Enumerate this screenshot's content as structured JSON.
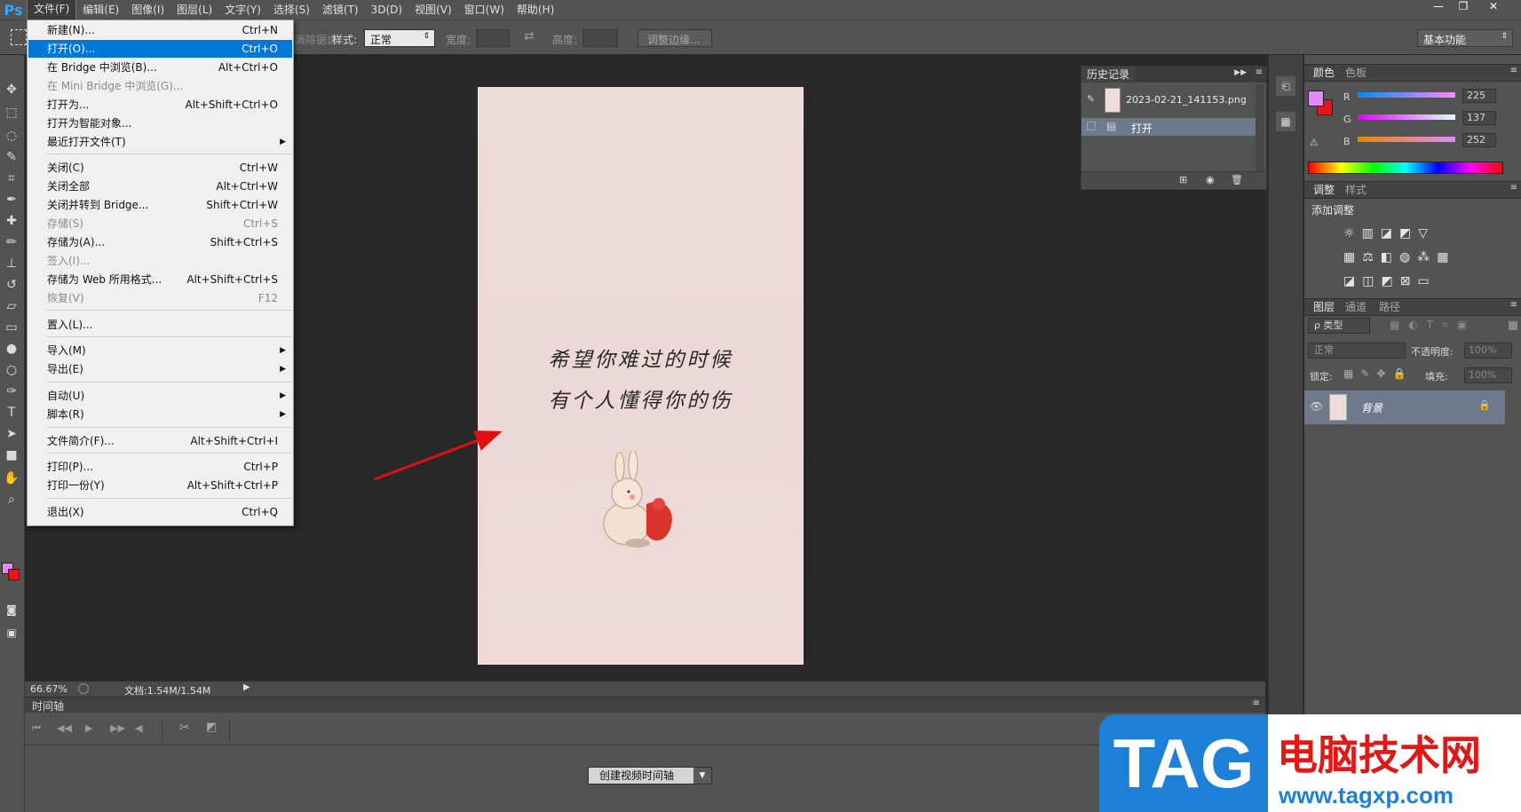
{
  "menubar": {
    "logo": "Ps",
    "items": [
      "文件(F)",
      "编辑(E)",
      "图像(I)",
      "图层(L)",
      "文字(Y)",
      "选择(S)",
      "滤镜(T)",
      "3D(D)",
      "视图(V)",
      "窗口(W)",
      "帮助(H)"
    ],
    "window_controls": [
      "—",
      "❐",
      "✕"
    ]
  },
  "options": {
    "refine_label": "消除锯齿",
    "style_label": "样式:",
    "style_value": "正常",
    "width_label": "宽度:",
    "height_label": "高度:",
    "refine_edge_button": "调整边缘...",
    "workspace": "基本功能"
  },
  "file_menu": {
    "items": [
      {
        "label": "新建(N)...",
        "shortcut": "Ctrl+N"
      },
      {
        "label": "打开(O)...",
        "shortcut": "Ctrl+O",
        "highlighted": true
      },
      {
        "label": "在 Bridge 中浏览(B)...",
        "shortcut": "Alt+Ctrl+O"
      },
      {
        "label": "在 Mini Bridge 中浏览(G)...",
        "shortcut": "",
        "disabled": true
      },
      {
        "label": "打开为...",
        "shortcut": "Alt+Shift+Ctrl+O"
      },
      {
        "label": "打开为智能对象...",
        "shortcut": ""
      },
      {
        "label": "最近打开文件(T)",
        "shortcut": "",
        "submenu": true
      },
      {
        "label": "关闭(C)",
        "shortcut": "Ctrl+W"
      },
      {
        "label": "关闭全部",
        "shortcut": "Alt+Ctrl+W"
      },
      {
        "label": "关闭并转到 Bridge...",
        "shortcut": "Shift+Ctrl+W"
      },
      {
        "label": "存储(S)",
        "shortcut": "Ctrl+S",
        "disabled": true
      },
      {
        "label": "存储为(A)...",
        "shortcut": "Shift+Ctrl+S"
      },
      {
        "label": "签入(I)...",
        "shortcut": "",
        "disabled": true
      },
      {
        "label": "存储为 Web 所用格式...",
        "shortcut": "Alt+Shift+Ctrl+S"
      },
      {
        "label": "恢复(V)",
        "shortcut": "F12",
        "disabled": true
      },
      {
        "label": "置入(L)...",
        "shortcut": ""
      },
      {
        "label": "导入(M)",
        "shortcut": "",
        "submenu": true
      },
      {
        "label": "导出(E)",
        "shortcut": "",
        "submenu": true
      },
      {
        "label": "自动(U)",
        "shortcut": "",
        "submenu": true
      },
      {
        "label": "脚本(R)",
        "shortcut": "",
        "submenu": true
      },
      {
        "label": "文件简介(F)...",
        "shortcut": "Alt+Shift+Ctrl+I"
      },
      {
        "label": "打印(P)...",
        "shortcut": "Ctrl+P"
      },
      {
        "label": "打印一份(Y)",
        "shortcut": "Alt+Shift+Ctrl+P"
      },
      {
        "label": "退出(X)",
        "shortcut": "Ctrl+Q"
      }
    ]
  },
  "canvas": {
    "line1": "希望你难过的时候",
    "line2": "有个人懂得你的伤"
  },
  "status": {
    "zoom": "66.67%",
    "doc": "文档:1.54M/1.54M"
  },
  "timeline": {
    "title": "时间轴",
    "create_button": "创建视频时间轴"
  },
  "history": {
    "title": "历史记录",
    "snapshot": "2023-02-21_141153.png",
    "state": "打开"
  },
  "color_panel": {
    "tabs": [
      "颜色",
      "色板"
    ],
    "r_label": "R",
    "r": "225",
    "g_label": "G",
    "g": "137",
    "b_label": "B",
    "b": "252",
    "foreground": "#e189fc",
    "background": "#e8141c"
  },
  "adjustments": {
    "tabs": [
      "调整",
      "样式"
    ],
    "title": "添加调整"
  },
  "layers": {
    "tabs": [
      "图层",
      "通道",
      "路径"
    ],
    "filter": "ρ 类型",
    "blend": "正常",
    "opacity_label": "不透明度:",
    "opacity": "100%",
    "lock_label": "锁定:",
    "fill_label": "填充:",
    "fill": "100%",
    "layer_name": "背景"
  },
  "watermark": {
    "tag": "TAG",
    "title": "电脑技术网",
    "url": "www.tagxp.com"
  }
}
